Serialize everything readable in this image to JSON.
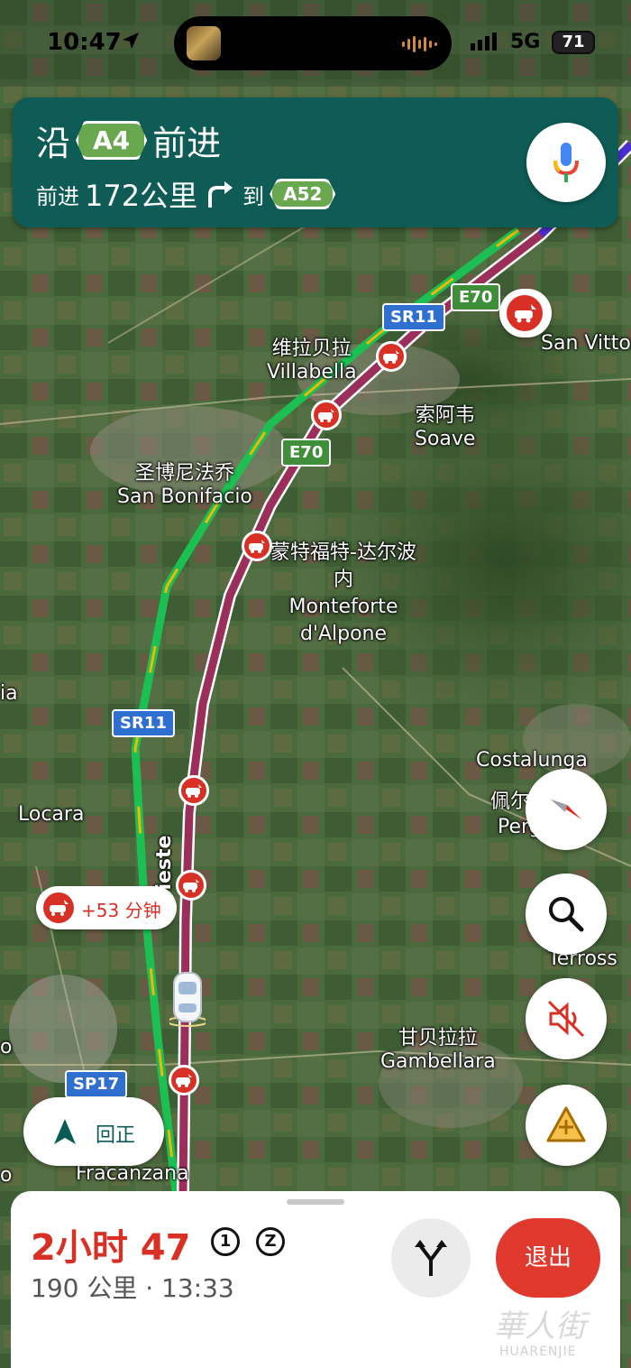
{
  "status_bar": {
    "time": "10:47",
    "network": "5G",
    "battery": "71"
  },
  "banner": {
    "prefix": "沿",
    "road": "A4",
    "suffix": "前进",
    "sub_prefix": "前进",
    "distance": "172公里",
    "to": "到",
    "next_road": "A52"
  },
  "map": {
    "places": [
      {
        "cn": "维拉贝拉",
        "en": "Villabella"
      },
      {
        "cn": "索阿韦",
        "en": "Soave"
      },
      {
        "cn": "圣博尼法乔",
        "en": "San Bonifacio"
      },
      {
        "cn": "蒙特福特-达尔波内",
        "en": "Monteforte d'Alpone"
      },
      {
        "cn": "佩尔",
        "en": "Costalunga"
      },
      {
        "cn": "甘贝拉拉",
        "en": "Gambellara"
      }
    ],
    "labels": {
      "san_vittore": "San Vittor",
      "locara": "Locara",
      "fracanzana": "Fracanzana",
      "terross": "Terross",
      "perg": "Perg",
      "ia": "ia",
      "o_left": "o",
      "road_name": "Trieste",
      "costalunga": "Costalunga",
      "peier_cn": "佩尔"
    },
    "road_signs": {
      "sr11_top": "SR11",
      "sr11_mid": "SR11",
      "e70_top": "E70",
      "e70_mid": "E70",
      "sp17": "SP17"
    },
    "delay": "+53 分钟"
  },
  "controls": {
    "recenter_label": "回正",
    "icons": [
      "mic-icon",
      "compass-icon",
      "search-icon",
      "sound-off-icon",
      "report-incident-icon"
    ]
  },
  "sheet": {
    "eta_hours": "2小时",
    "eta_minutes": "47",
    "badge_1": "1",
    "badge_z": "Z",
    "summary": "190 公里 · 13:33",
    "exit_label": "退出"
  },
  "watermark": {
    "cn": "華人街",
    "en": "HUARENJIE"
  }
}
